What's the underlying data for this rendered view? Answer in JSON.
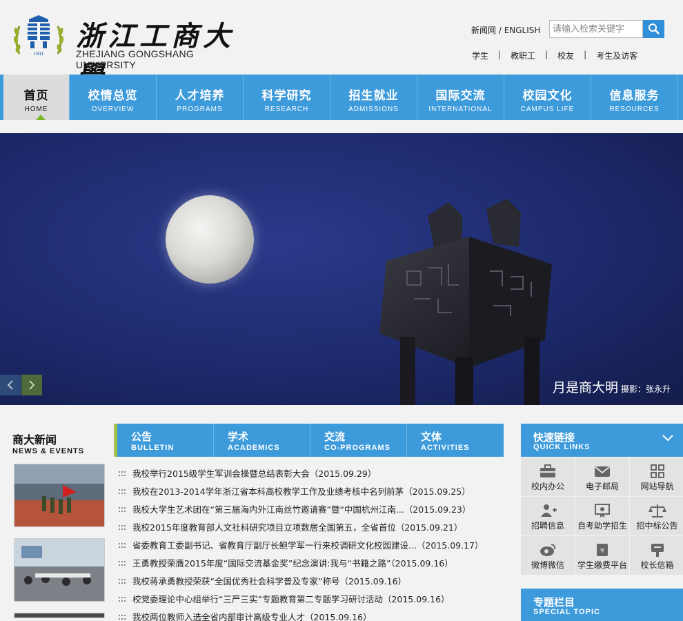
{
  "header": {
    "logo_cn": "浙江工商大學",
    "logo_en": "ZHEJIANG GONGSHANG UNIVERSITY",
    "seal_year": "1911",
    "top_links": {
      "news": "新闻网",
      "separator": " / ",
      "english": "ENGLISH"
    },
    "search": {
      "placeholder": "请输入检索关键字"
    },
    "audience": [
      "学生",
      "教职工",
      "校友",
      "考生及访客"
    ],
    "audience_sep": "|"
  },
  "nav": [
    {
      "cn": "首页",
      "en": "HOME",
      "active": true
    },
    {
      "cn": "校情总览",
      "en": "OVERVIEW"
    },
    {
      "cn": "人才培养",
      "en": "PROGRAMS"
    },
    {
      "cn": "科学研究",
      "en": "RESEARCH"
    },
    {
      "cn": "招生就业",
      "en": "ADMISSIONS"
    },
    {
      "cn": "国际交流",
      "en": "INTERNATIONAL"
    },
    {
      "cn": "校园文化",
      "en": "CAMPUS LIFE"
    },
    {
      "cn": "信息服务",
      "en": "RESOURCES"
    }
  ],
  "banner": {
    "caption": "月是商大明",
    "credit": "摄影：张永升"
  },
  "news": {
    "title_cn": "商大新闻",
    "title_en": "NEWS & EVENTS",
    "tabs": [
      {
        "cn": "公告",
        "en": "BULLETIN"
      },
      {
        "cn": "学术",
        "en": "ACADEMICS"
      },
      {
        "cn": "交流",
        "en": "CO-PROGRAMS"
      },
      {
        "cn": "文体",
        "en": "ACTIVITIES"
      }
    ],
    "items": [
      "我校举行2015级学生军训会操暨总结表彰大会（2015.09.29）",
      "我校在2013-2014学年浙江省本科高校教学工作及业绩考核中名列前茅（2015.09.25）",
      "我校大学生艺术团在“第三届海内外江南丝竹邀请赛”暨“中国杭州江南...（2015.09.23）",
      "我校2015年度教育部人文社科研究项目立项数居全国第五，全省首位（2015.09.21）",
      "省委教育工委副书记、省教育厅副厅长鲍学军一行来校调研文化校园建设...（2015.09.17）",
      "王勇教授荣膺2015年度“国际交流基金奖”纪念演讲:我与“书籍之路”（2015.09.16）",
      "我校蒋承勇教授荣获“全国优秀社会科学普及专家”称号（2015.09.16）",
      "校党委理论中心组举行“三严三实”专题教育第二专题学习研讨活动（2015.09.16）",
      "我校两位教师入选全省内部审计高级专业人才（2015.09.16）"
    ]
  },
  "quick_links": {
    "title_cn": "快速链接",
    "title_en": "QUICK LINKS",
    "items": [
      {
        "label": "校内办公",
        "icon": "briefcase-icon"
      },
      {
        "label": "电子邮局",
        "icon": "mail-icon"
      },
      {
        "label": "网站导航",
        "icon": "grid-icon"
      },
      {
        "label": "招聘信息",
        "icon": "add-user-icon"
      },
      {
        "label": "自考助学招生",
        "icon": "certificate-icon"
      },
      {
        "label": "招中标公告",
        "icon": "scale-icon"
      },
      {
        "label": "微博微信",
        "icon": "weibo-icon"
      },
      {
        "label": "学生缴费平台",
        "icon": "payment-icon"
      },
      {
        "label": "校长信箱",
        "icon": "mailbox-icon"
      }
    ]
  },
  "special_topic": {
    "title_cn": "专题栏目",
    "title_en": "SPECIAL TOPIC"
  },
  "colors": {
    "primary_blue": "#3e9bdb",
    "accent_green": "#76b82a",
    "banner_night": "#1d2a6c"
  }
}
